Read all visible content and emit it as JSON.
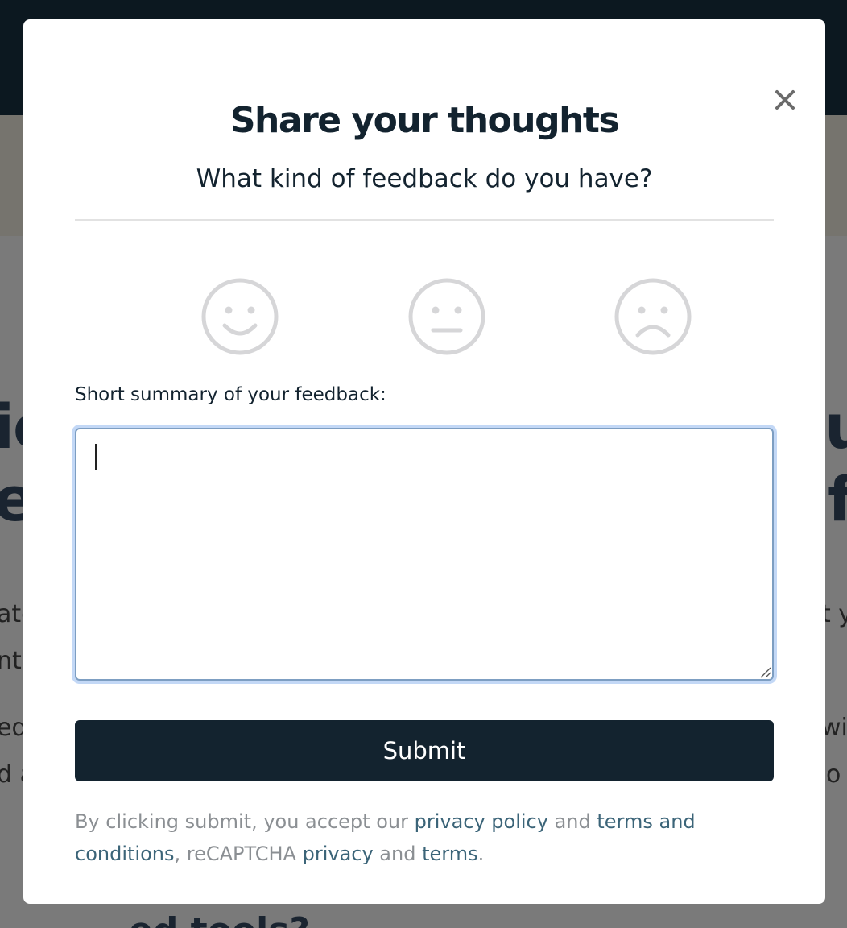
{
  "background": {
    "fragments": [
      "ic",
      "e",
      "ate",
      "nt",
      "ed",
      "d a",
      "u",
      "f",
      "t y",
      "wil",
      "o",
      "ed tools?"
    ]
  },
  "modal": {
    "title": "Share your thoughts",
    "subtitle": "What kind of feedback do you have?",
    "faces": [
      "happy-face-icon",
      "neutral-face-icon",
      "sad-face-icon"
    ],
    "field_label": "Short summary of your feedback:",
    "textarea_value": "",
    "submit_label": "Submit",
    "legal": {
      "prefix": "By clicking submit, you accept our ",
      "privacy_policy": "privacy policy",
      "and1": " and ",
      "terms_and_conditions": "terms and conditions",
      "mid": ", reCAPTCHA ",
      "privacy": "privacy",
      "and2": " and ",
      "terms": "terms",
      "suffix": "."
    }
  },
  "colors": {
    "dark_navy": "#13232f",
    "link": "#3b6478",
    "focus_ring": "#c3d8f6",
    "face_gray": "#d6d6d8"
  }
}
